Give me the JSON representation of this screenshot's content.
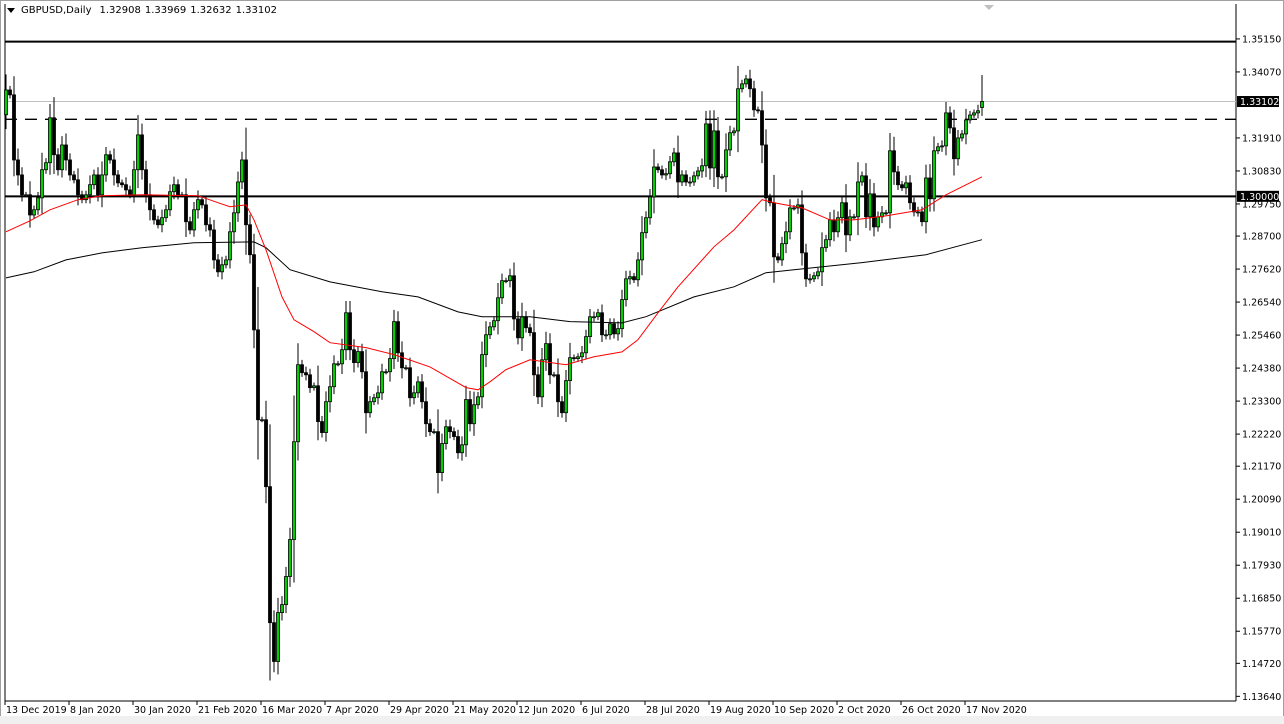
{
  "header": {
    "symbol": "GBPUSD,Daily",
    "open": "1.32908",
    "high": "1.33969",
    "low": "1.32632",
    "close": "1.33102"
  },
  "colors": {
    "bull_body": "#00d000",
    "bear_body": "#000000",
    "ma_fast": "#ff0000",
    "ma_slow": "#000000",
    "bid_line": "#c0c0c0"
  },
  "chart_data": {
    "type": "candlestick",
    "title": "GBPUSD,Daily",
    "ylim": [
      1.1352,
      1.3626
    ],
    "y_ticks": [
      "1.35150",
      "1.34070",
      "1.31910",
      "1.30830",
      "1.29750",
      "1.28700",
      "1.27620",
      "1.26540",
      "1.25460",
      "1.24380",
      "1.23300",
      "1.22220",
      "1.21170",
      "1.20090",
      "1.19010",
      "1.17930",
      "1.16850",
      "1.15770",
      "1.14720",
      "1.13640"
    ],
    "x_ticks": [
      {
        "bar": 0,
        "label": "13 Dec 2019"
      },
      {
        "bar": 16,
        "label": "8 Jan 2020"
      },
      {
        "bar": 32,
        "label": "30 Jan 2020"
      },
      {
        "bar": 48,
        "label": "21 Feb 2020"
      },
      {
        "bar": 64,
        "label": "16 Mar 2020"
      },
      {
        "bar": 80,
        "label": "7 Apr 2020"
      },
      {
        "bar": 96,
        "label": "29 Apr 2020"
      },
      {
        "bar": 112,
        "label": "21 May 2020"
      },
      {
        "bar": 128,
        "label": "12 Jun 2020"
      },
      {
        "bar": 144,
        "label": "6 Jul 2020"
      },
      {
        "bar": 160,
        "label": "28 Jul 2020"
      },
      {
        "bar": 176,
        "label": "19 Aug 2020"
      },
      {
        "bar": 192,
        "label": "10 Sep 2020"
      },
      {
        "bar": 208,
        "label": "2 Oct 2020"
      },
      {
        "bar": 224,
        "label": "26 Oct 2020"
      },
      {
        "bar": 240,
        "label": "17 Nov 2020"
      }
    ],
    "first_open": 1.3267,
    "closes": [
      1.3348,
      1.3332,
      1.3119,
      1.307,
      1.3005,
      1.3005,
      1.2939,
      1.2956,
      1.2995,
      1.3087,
      1.311,
      1.3257,
      1.3136,
      1.3087,
      1.3168,
      1.3119,
      1.307,
      1.3054,
      1.3005,
      1.2989,
      1.3005,
      1.3038,
      1.307,
      1.3005,
      1.307,
      1.3136,
      1.3119,
      1.307,
      1.3044,
      1.3038,
      1.3021,
      1.3005,
      1.3087,
      1.3201,
      1.3087,
      1.3005,
      1.2956,
      1.2923,
      1.2907,
      1.293,
      1.2956,
      1.3015,
      1.3038,
      1.3005,
      1.3005,
      1.2917,
      1.289,
      1.2956,
      1.2989,
      1.2972,
      1.2907,
      1.289,
      1.2792,
      1.2753,
      1.2776,
      1.2792,
      1.2884,
      1.2946,
      1.3047,
      1.3119,
      1.2907,
      1.2809,
      1.2563,
      1.2269,
      1.2269,
      1.205,
      1.1605,
      1.1478,
      1.1638,
      1.1664,
      1.1756,
      1.1877,
      1.2197,
      1.2449,
      1.2423,
      1.2416,
      1.2374,
      1.238,
      1.2263,
      1.2227,
      1.2328,
      1.2377,
      1.2452,
      1.2452,
      1.2498,
      1.2619,
      1.2498,
      1.2456,
      1.2492,
      1.2426,
      1.2292,
      1.2328,
      1.2341,
      1.2357,
      1.2426,
      1.2426,
      1.2469,
      1.259,
      1.2488,
      1.2439,
      1.2439,
      1.2341,
      1.2357,
      1.2393,
      1.2328,
      1.2256,
      1.223,
      1.223,
      1.2096,
      1.2191,
      1.2246,
      1.223,
      1.2214,
      1.2161,
      1.2187,
      1.2335,
      1.2256,
      1.2318,
      1.2344,
      1.2482,
      1.2547,
      1.2573,
      1.2593,
      1.2668,
      1.2724,
      1.2724,
      1.274,
      1.2599,
      1.2537,
      1.2606,
      1.257,
      1.2554,
      1.2416,
      1.2344,
      1.2465,
      1.2518,
      1.2416,
      1.2416,
      1.2328,
      1.2292,
      1.2397,
      1.2472,
      1.2469,
      1.2475,
      1.2488,
      1.2541,
      1.2606,
      1.2606,
      1.2619,
      1.2547,
      1.2547,
      1.2583,
      1.255,
      1.2567,
      1.2662,
      1.273,
      1.2737,
      1.2727,
      1.2792,
      1.2881,
      1.293,
      1.2998,
      1.3096,
      1.3087,
      1.307,
      1.3074,
      1.3113,
      1.3142,
      1.3047,
      1.307,
      1.3047,
      1.3047,
      1.3067,
      1.3083,
      1.31,
      1.3237,
      1.3093,
      1.3214,
      1.3064,
      1.3064,
      1.3152,
      1.3208,
      1.3214,
      1.3352,
      1.3368,
      1.3384,
      1.3352,
      1.3283,
      1.328,
      1.3168,
      1.2995,
      1.2979,
      1.2802,
      1.2792,
      1.2845,
      1.2884,
      1.2962,
      1.2962,
      1.2972,
      1.2815,
      1.273,
      1.273,
      1.274,
      1.2753,
      1.2832,
      1.2858,
      1.2923,
      1.2884,
      1.293,
      1.2979,
      1.2874,
      1.2933,
      1.2933,
      1.3047,
      1.3067,
      1.2933,
      1.3008,
      1.29,
      1.2933,
      1.2946,
      1.2946,
      1.3149,
      1.308,
      1.3038,
      1.3028,
      1.3044,
      1.2979,
      1.2949,
      1.2949,
      1.2917,
      1.306,
      1.2992,
      1.3149,
      1.3162,
      1.3165,
      1.3273,
      1.3224,
      1.3123,
      1.3191,
      1.3204,
      1.325,
      1.3266,
      1.3273,
      1.328,
      1.331
    ],
    "last_bar": {
      "open": 1.32908,
      "high": 1.33969,
      "low": 1.32632,
      "close": 1.33102
    },
    "ma_fast": [
      [
        0,
        1.2884
      ],
      [
        6,
        1.292
      ],
      [
        11,
        1.2956
      ],
      [
        18,
        1.2989
      ],
      [
        24,
        1.3002
      ],
      [
        34,
        1.3005
      ],
      [
        48,
        1.3002
      ],
      [
        53,
        1.2979
      ],
      [
        56,
        1.2966
      ],
      [
        60,
        1.2972
      ],
      [
        62,
        1.2923
      ],
      [
        65,
        1.2825
      ],
      [
        69,
        1.2671
      ],
      [
        72,
        1.2596
      ],
      [
        77,
        1.2557
      ],
      [
        81,
        1.2521
      ],
      [
        90,
        1.2505
      ],
      [
        97,
        1.2482
      ],
      [
        106,
        1.2442
      ],
      [
        115,
        1.2374
      ],
      [
        118,
        1.2367
      ],
      [
        121,
        1.2393
      ],
      [
        125,
        1.2433
      ],
      [
        131,
        1.2465
      ],
      [
        140,
        1.2449
      ],
      [
        147,
        1.2475
      ],
      [
        154,
        1.2491
      ],
      [
        158,
        1.2531
      ],
      [
        163,
        1.2619
      ],
      [
        168,
        1.2704
      ],
      [
        177,
        1.2835
      ],
      [
        182,
        1.289
      ],
      [
        189,
        1.2989
      ],
      [
        192,
        1.2979
      ],
      [
        199,
        1.2962
      ],
      [
        206,
        1.2923
      ],
      [
        212,
        1.2923
      ],
      [
        220,
        1.2936
      ],
      [
        229,
        1.2956
      ],
      [
        235,
        1.3005
      ],
      [
        244,
        1.3064
      ]
    ],
    "ma_slow": [
      [
        0,
        1.2733
      ],
      [
        7,
        1.2753
      ],
      [
        15,
        1.2792
      ],
      [
        24,
        1.2815
      ],
      [
        34,
        1.2832
      ],
      [
        47,
        1.2848
      ],
      [
        62,
        1.2851
      ],
      [
        65,
        1.2832
      ],
      [
        71,
        1.276
      ],
      [
        81,
        1.272
      ],
      [
        94,
        1.2688
      ],
      [
        103,
        1.2671
      ],
      [
        113,
        1.2622
      ],
      [
        119,
        1.2606
      ],
      [
        131,
        1.2606
      ],
      [
        141,
        1.259
      ],
      [
        154,
        1.2586
      ],
      [
        160,
        1.2606
      ],
      [
        172,
        1.2671
      ],
      [
        182,
        1.2704
      ],
      [
        190,
        1.275
      ],
      [
        197,
        1.276
      ],
      [
        214,
        1.2783
      ],
      [
        230,
        1.2809
      ],
      [
        244,
        1.2858
      ]
    ],
    "levels": {
      "resistance_solid": 1.3506,
      "dashed": 1.3252,
      "support_solid": 1.3,
      "bid": 1.33102
    },
    "level_labels": {
      "bid": "1.33102",
      "support": "1.30000"
    }
  }
}
